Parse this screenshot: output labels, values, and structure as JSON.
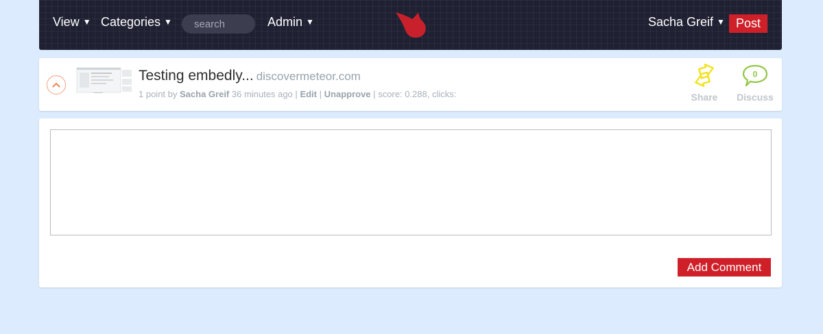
{
  "colors": {
    "page_bg": "#dcecfe",
    "navbar_bg": "#1f2032",
    "accent_red": "#cf2029",
    "share_yellow": "#f2e21a",
    "discuss_green": "#8fc741",
    "upvote_orange": "#f08a5d"
  },
  "nav": {
    "view_label": "View",
    "categories_label": "Categories",
    "search_placeholder": "search",
    "admin_label": "Admin",
    "user_label": "Sacha Greif",
    "post_label": "Post",
    "logo_icon": "flame-logo-icon"
  },
  "post": {
    "title": "Testing embedly...",
    "domain": "discovermeteor.com",
    "points": "1 point by",
    "author": "Sacha Greif",
    "time": "36 minutes ago",
    "sep1": "|",
    "edit": "Edit",
    "sep2": "|",
    "unapprove": "Unapprove",
    "sep3": "|",
    "score": "score: 0.288, clicks:",
    "share_label": "Share",
    "discuss_label": "Discuss",
    "comment_count": "0"
  },
  "comment": {
    "value": "",
    "submit_label": "Add Comment"
  }
}
